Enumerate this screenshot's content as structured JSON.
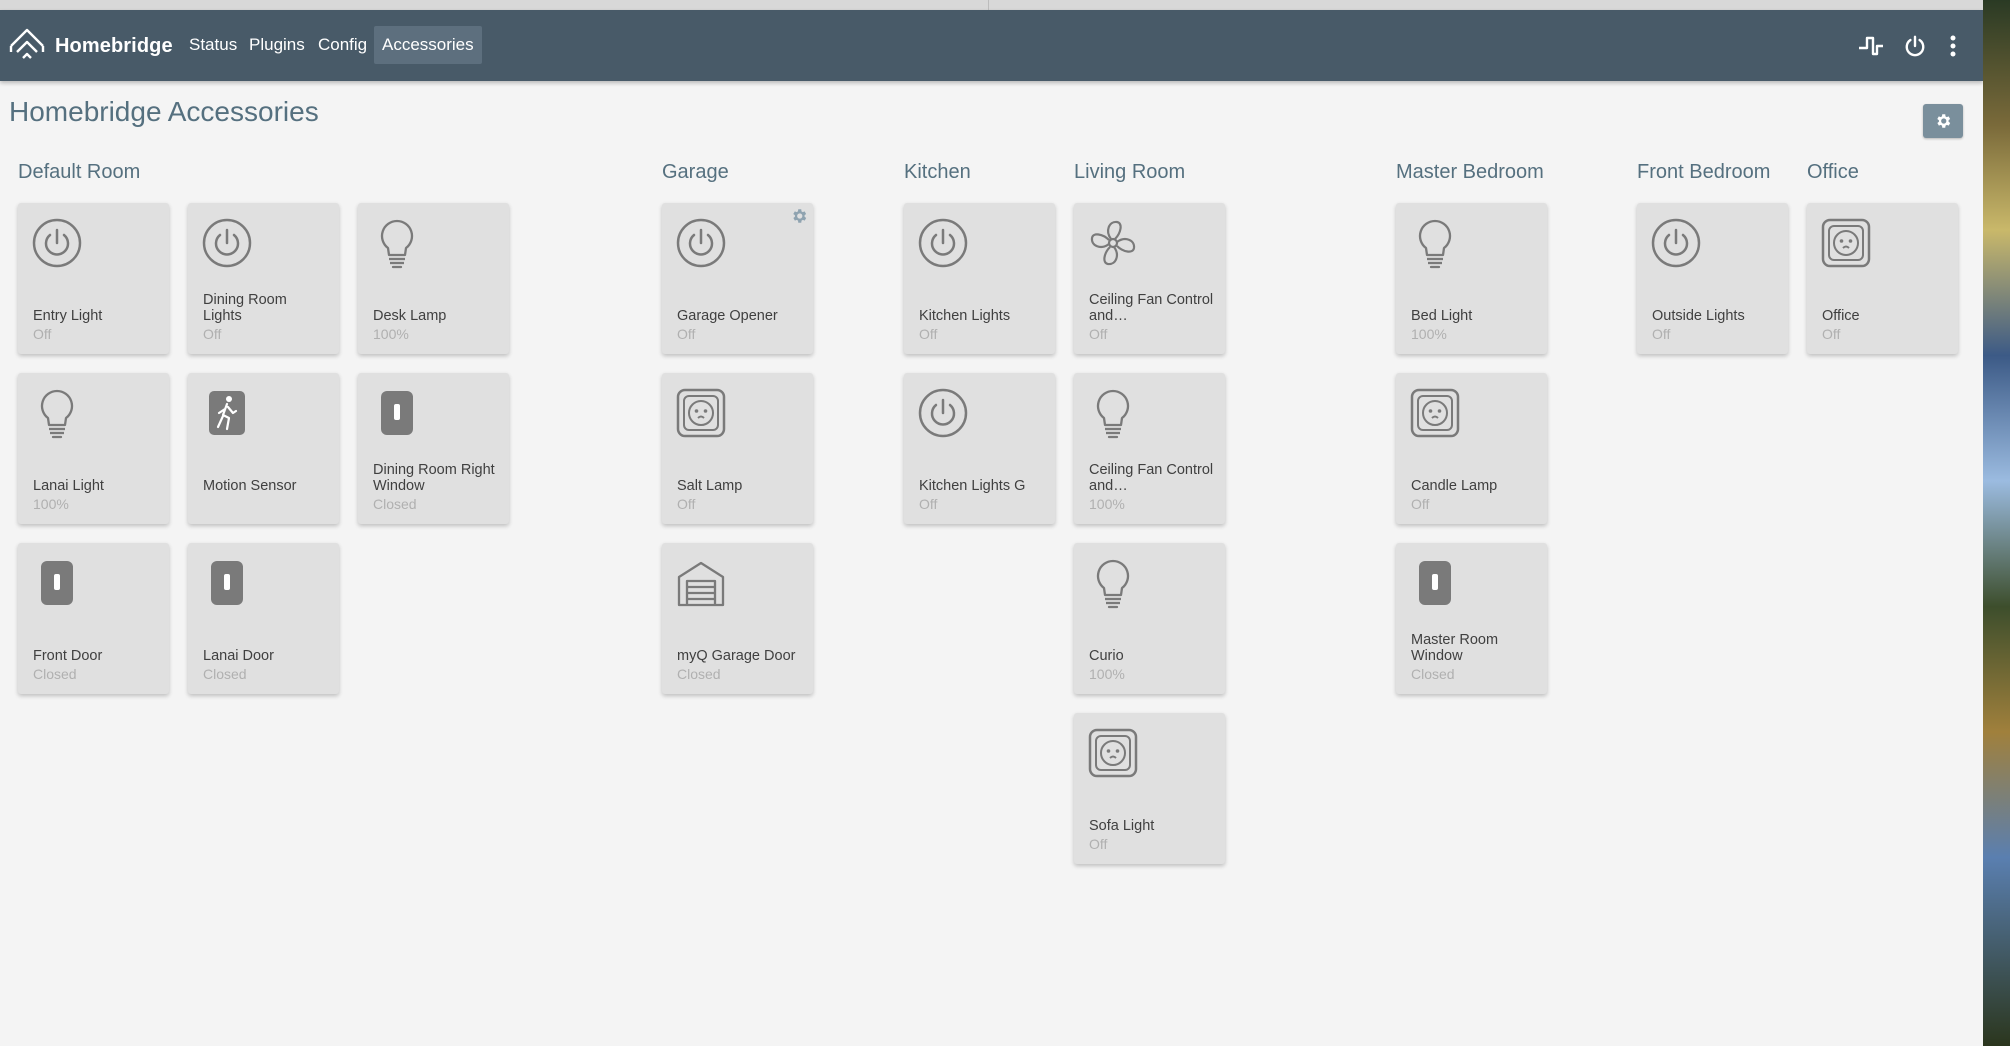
{
  "navbar": {
    "brand": "Homebridge",
    "links": [
      {
        "label": "Status",
        "active": false
      },
      {
        "label": "Plugins",
        "active": false
      },
      {
        "label": "Config",
        "active": false
      },
      {
        "label": "Accessories",
        "active": true
      }
    ],
    "right_icons": [
      "logs-icon",
      "power-icon",
      "more-vertical-icon"
    ],
    "color": "#485a68"
  },
  "page": {
    "title": "Homebridge Accessories",
    "settings_icon": "gear-icon"
  },
  "rooms": [
    {
      "name": "Default Room",
      "accessories": [
        {
          "name": "Entry Light",
          "state": "Off",
          "icon": "power-icon"
        },
        {
          "name": "Dining Room Lights",
          "state": "Off",
          "icon": "power-icon"
        },
        {
          "name": "Desk Lamp",
          "state": "100%",
          "icon": "lightbulb-icon"
        },
        {
          "name": "Lanai Light",
          "state": "100%",
          "icon": "lightbulb-icon"
        },
        {
          "name": "Motion Sensor",
          "state": "",
          "icon": "motion-sensor-icon"
        },
        {
          "name": "Dining Room Right Window",
          "state": "Closed",
          "icon": "contact-sensor-icon"
        },
        {
          "name": "Front Door",
          "state": "Closed",
          "icon": "contact-sensor-icon"
        },
        {
          "name": "Lanai Door",
          "state": "Closed",
          "icon": "contact-sensor-icon"
        }
      ]
    },
    {
      "name": "Garage",
      "accessories": [
        {
          "name": "Garage Opener",
          "state": "Off",
          "icon": "power-icon",
          "gear": true
        },
        {
          "name": "Salt Lamp",
          "state": "Off",
          "icon": "outlet-icon"
        },
        {
          "name": "myQ Garage Door",
          "state": "Closed",
          "icon": "garage-door-icon"
        }
      ]
    },
    {
      "name": "Kitchen",
      "accessories": [
        {
          "name": "Kitchen Lights",
          "state": "Off",
          "icon": "power-icon"
        },
        {
          "name": "Kitchen Lights G",
          "state": "Off",
          "icon": "power-icon"
        }
      ]
    },
    {
      "name": "Living Room",
      "accessories": [
        {
          "name": "Ceiling Fan Control and…",
          "state": "Off",
          "icon": "fan-icon"
        },
        {
          "name": "Ceiling Fan Control and…",
          "state": "100%",
          "icon": "lightbulb-icon"
        },
        {
          "name": "Curio",
          "state": "100%",
          "icon": "lightbulb-icon"
        },
        {
          "name": "Sofa Light",
          "state": "Off",
          "icon": "outlet-icon"
        }
      ]
    },
    {
      "name": "Master Bedroom",
      "accessories": [
        {
          "name": "Bed Light",
          "state": "100%",
          "icon": "lightbulb-icon"
        },
        {
          "name": "Candle Lamp",
          "state": "Off",
          "icon": "outlet-icon"
        },
        {
          "name": "Master Room Window",
          "state": "Closed",
          "icon": "contact-sensor-icon"
        }
      ]
    },
    {
      "name": "Front Bedroom",
      "accessories": [
        {
          "name": "Outside Lights",
          "state": "Off",
          "icon": "power-icon"
        }
      ]
    },
    {
      "name": "Office",
      "accessories": [
        {
          "name": "Office",
          "state": "Off",
          "icon": "outlet-icon"
        }
      ]
    }
  ]
}
